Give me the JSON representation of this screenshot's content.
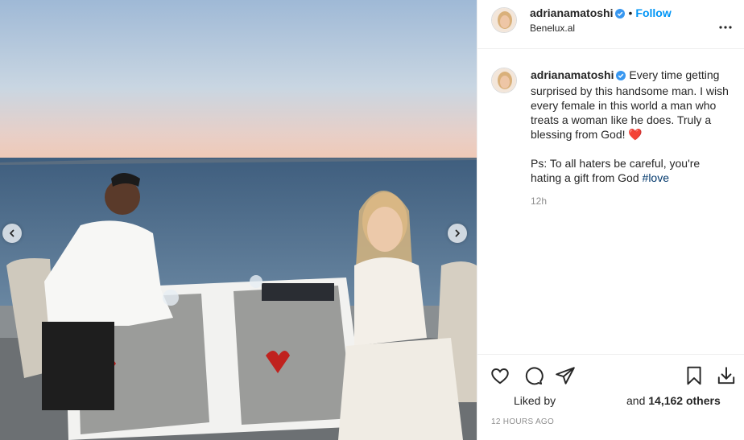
{
  "post": {
    "username": "adrianamatoshi",
    "follow_label": "Follow",
    "separator": "•",
    "location": "Benelux.al"
  },
  "caption": {
    "username": "adrianamatoshi",
    "text_line_1": "Every time getting surprised by this handsome man. I wish every female in this world a man who treats a woman like he does. Truly a blessing from God! ",
    "heart_emoji": "❤️",
    "text_line_2": "Ps: To all haters be careful, you're hating a gift from God ",
    "hashtag": "#love",
    "time": "12h"
  },
  "engagement": {
    "liked_by_label": "Liked by",
    "and_label": "and",
    "others_count": "14,162 others",
    "posted_time": "12 HOURS AGO"
  },
  "icons": {
    "verified": "verified-badge-icon",
    "more": "more-options-icon",
    "like": "heart-icon",
    "comment": "comment-icon",
    "share": "share-icon",
    "save": "bookmark-icon",
    "download": "download-icon",
    "prev": "chevron-left-icon",
    "next": "chevron-right-icon"
  },
  "colors": {
    "accent": "#0095f6",
    "verified": "#3897f0",
    "hashtag": "#00376b",
    "muted": "#8e8e8e"
  }
}
